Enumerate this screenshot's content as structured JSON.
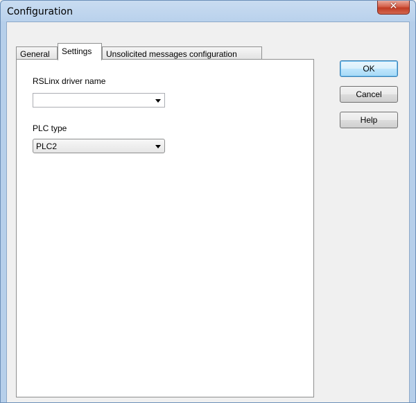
{
  "window": {
    "title": "Configuration",
    "close_glyph": "✕"
  },
  "tabs": [
    {
      "label": "General",
      "active": false
    },
    {
      "label": "Settings",
      "active": true
    },
    {
      "label": "Unsolicited messages configuration",
      "active": false
    }
  ],
  "settings": {
    "driver_label": "RSLinx driver name",
    "driver_value": "",
    "plc_label": "PLC type",
    "plc_value": "PLC2"
  },
  "buttons": {
    "ok": "OK",
    "cancel": "Cancel",
    "help": "Help"
  },
  "icons": {
    "close": "close-icon",
    "dropdown": "chevron-down-icon"
  }
}
